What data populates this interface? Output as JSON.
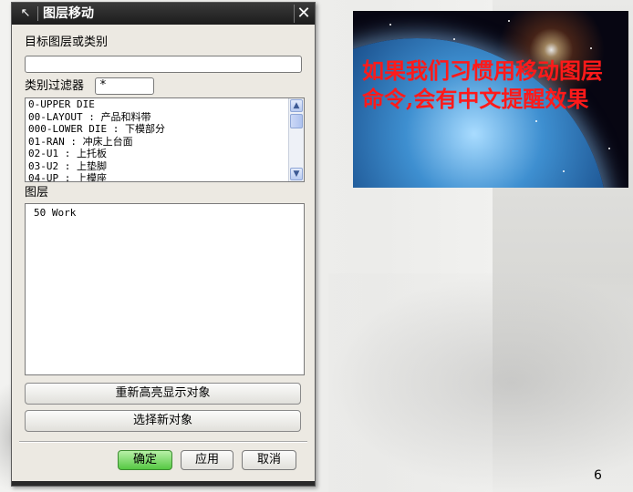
{
  "dialog": {
    "title": "图层移动",
    "target_label": "目标图层或类别",
    "target_value": "",
    "filter_label": "类别过滤器",
    "filter_value": "*",
    "categories": [
      "0-UPPER DIE",
      "00-LAYOUT : 产品和料带",
      "000-LOWER DIE : 下模部分",
      "01-RAN : 冲床上台面",
      "02-U1 : 上托板",
      "03-U2 : 上垫脚",
      "04-UP : 上模座"
    ],
    "layer_label": "图层",
    "layers": [
      "50 Work"
    ],
    "reselect_label": "重新高亮显示对象",
    "select_new_label": "选择新对象",
    "ok_label": "确定",
    "apply_label": "应用",
    "cancel_label": "取消",
    "close_glyph": "✕",
    "title_icon": "pointer-icon"
  },
  "callout": {
    "text": "如果我们习惯用移动图层命令,会有中文提醒效果"
  },
  "page_number": "6",
  "colors": {
    "callout_text": "#ff1a1a",
    "ok_button": "#56c843",
    "titlebar": "#1c1c1c"
  }
}
